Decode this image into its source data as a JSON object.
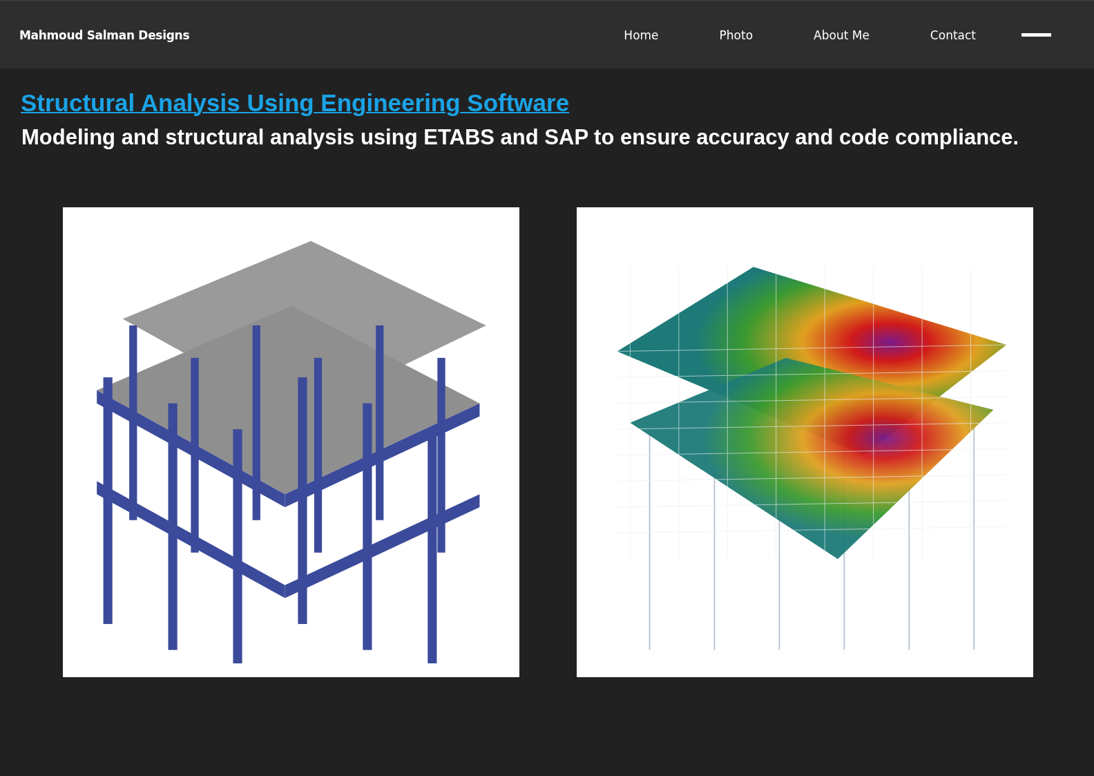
{
  "header": {
    "brand": "Mahmoud Salman Designs",
    "nav": [
      {
        "label": "Home"
      },
      {
        "label": "Photo"
      },
      {
        "label": "About Me"
      },
      {
        "label": "Contact"
      }
    ]
  },
  "section": {
    "title": "Structural Analysis Using Engineering Software",
    "subtitle": "Modeling and structural analysis using ETABS and SAP to ensure accuracy and code compliance."
  },
  "gallery": [
    {
      "kind": "frame"
    },
    {
      "kind": "mesh"
    }
  ]
}
